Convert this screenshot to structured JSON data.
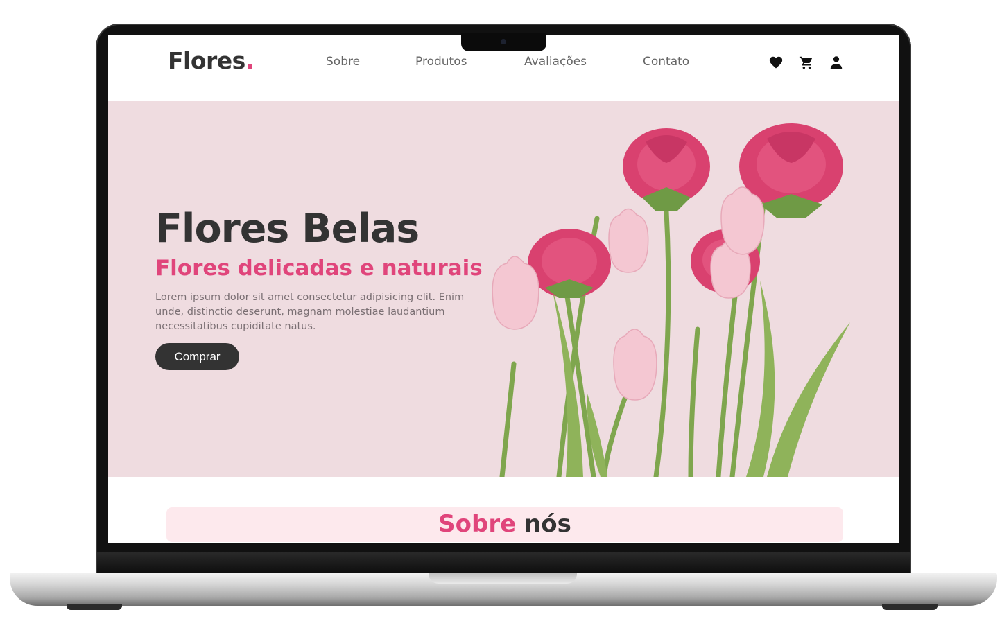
{
  "brand": {
    "name": "Flores",
    "dot": ".",
    "accent_color": "#e0457b",
    "text_color": "#333333"
  },
  "nav": {
    "links": [
      "Sobre",
      "Produtos",
      "Avaliações",
      "Contato"
    ],
    "icons": [
      "heart-icon",
      "cart-icon",
      "user-icon"
    ]
  },
  "hero": {
    "title": "Flores Belas",
    "subtitle": "Flores delicadas e naturais",
    "text": "Lorem ipsum dolor sit amet consectetur adipisicing elit. Enim unde, distinctio deserunt, magnam molestiae laudantium necessitatibus cupiditate natus.",
    "button": "Comprar",
    "background": "#efdce0"
  },
  "about": {
    "title_highlight": "Sobre",
    "title_rest": "nós"
  }
}
